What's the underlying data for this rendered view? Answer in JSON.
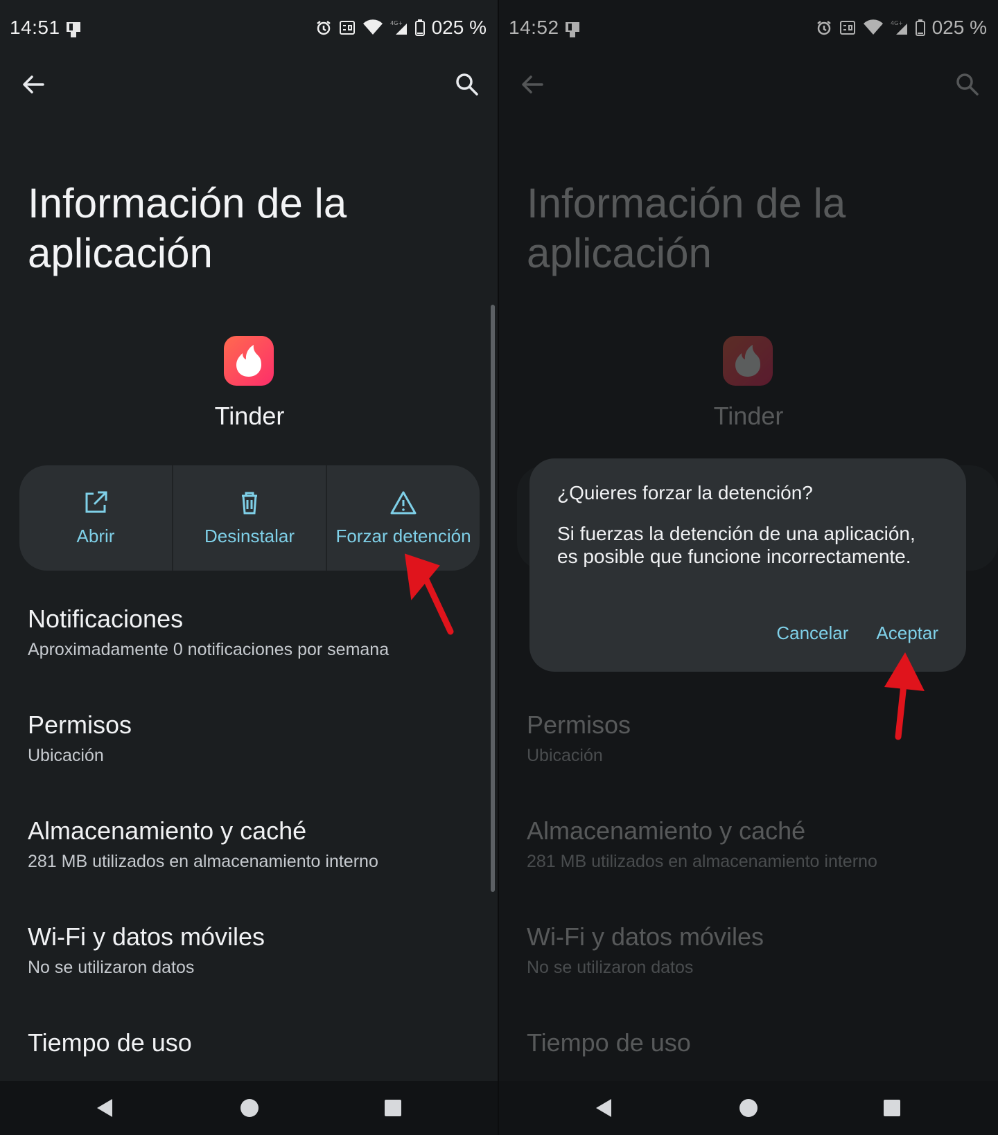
{
  "colors": {
    "accent": "#7fd0e8",
    "background": "#1b1e20",
    "card": "#2b2f32",
    "annotation_arrow": "#e0141c",
    "tinder_gradient": [
      "#ff6a4f",
      "#fd2e6a"
    ]
  },
  "left_screen": {
    "status_bar": {
      "time": "14:51",
      "battery": "025 %"
    },
    "page_title": "Información de la aplicación",
    "app": {
      "name": "Tinder",
      "icon": "tinder-flame-icon"
    },
    "actions": [
      {
        "label": "Abrir",
        "icon": "open-external-icon"
      },
      {
        "label": "Desinstalar",
        "icon": "trash-icon"
      },
      {
        "label": "Forzar detención",
        "icon": "warning-triangle-icon"
      }
    ],
    "items": [
      {
        "title": "Notificaciones",
        "subtitle": "Aproximadamente 0 notificaciones por semana"
      },
      {
        "title": "Permisos",
        "subtitle": "Ubicación"
      },
      {
        "title": "Almacenamiento y caché",
        "subtitle": "281 MB utilizados en almacenamiento interno"
      },
      {
        "title": "Wi-Fi y datos móviles",
        "subtitle": "No se utilizaron datos"
      },
      {
        "title": "Tiempo de uso",
        "subtitle": ""
      }
    ]
  },
  "right_screen": {
    "status_bar": {
      "time": "14:52",
      "battery": "025 %"
    },
    "page_title": "Información de la aplicación",
    "app": {
      "name": "Tinder"
    },
    "items": [
      {
        "title": "Permisos",
        "subtitle": "Ubicación"
      },
      {
        "title": "Almacenamiento y caché",
        "subtitle": "281 MB utilizados en almacenamiento interno"
      },
      {
        "title": "Wi-Fi y datos móviles",
        "subtitle": "No se utilizaron datos"
      },
      {
        "title": "Tiempo de uso",
        "subtitle": ""
      }
    ],
    "dialog": {
      "title": "¿Quieres forzar la detención?",
      "body": "Si fuerzas la detención de una aplicación, es posible que funcione incorrectamente.",
      "cancel": "Cancelar",
      "accept": "Aceptar"
    }
  }
}
